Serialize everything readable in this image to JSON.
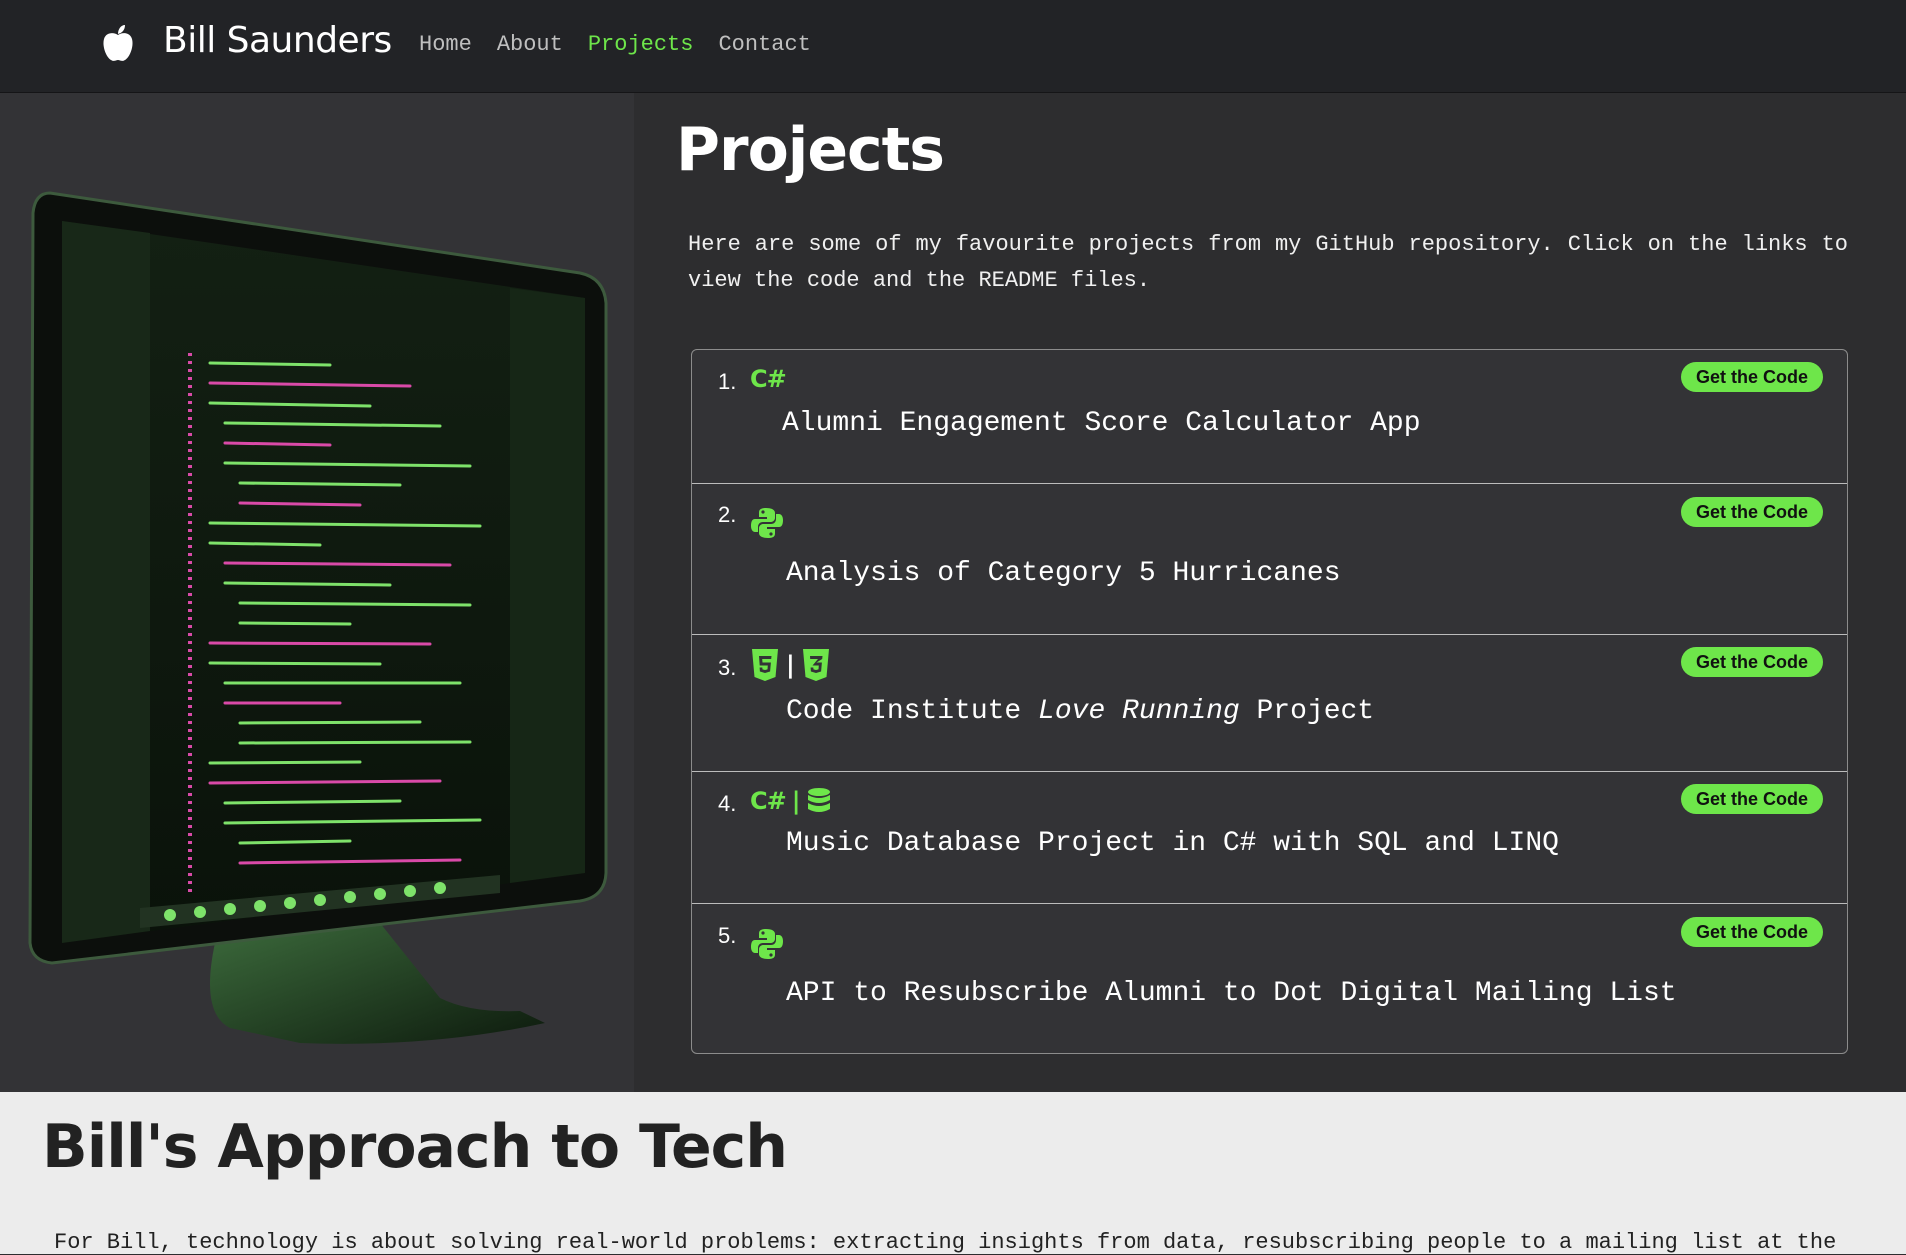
{
  "nav": {
    "brand": "Bill Saunders",
    "brand_icon": "apple-icon",
    "links": [
      "Home",
      "About",
      "Projects",
      "Contact"
    ],
    "active": "Projects"
  },
  "projects_section": {
    "title": "Projects",
    "intro": "Here are some of my favourite projects from my GitHub repository. Click on the links to view the code and the README files.",
    "button_label": "Get the Code",
    "items": [
      {
        "number": "1.",
        "icons": [
          "csharp-icon"
        ],
        "icon_text": "C#",
        "title": "Alumni Engagement Score Calculator App"
      },
      {
        "number": "2.",
        "icons": [
          "python-icon"
        ],
        "title": "Analysis of Category 5 Hurricanes"
      },
      {
        "number": "3.",
        "icons": [
          "html5-icon",
          "css3-icon"
        ],
        "title_pre": "Code Institute ",
        "title_em": "Love Running",
        "title_post": " Project"
      },
      {
        "number": "4.",
        "icons": [
          "csharp-icon",
          "database-icon"
        ],
        "icon_text": "C#",
        "title": "Music Database Project in C# with SQL and LINQ"
      },
      {
        "number": "5.",
        "icons": [
          "python-icon"
        ],
        "title": "API to Resubscribe Alumni to Dot Digital Mailing List"
      }
    ]
  },
  "approach_section": {
    "title": "Bill's Approach to Tech",
    "text": "For Bill, technology is about solving real-world problems: extracting insights from data, resubscribing people to a mailing list at the"
  },
  "colors": {
    "accent": "#6ee64a",
    "nav_bg": "#222326",
    "panel_bg": "#2d2d2f",
    "light_bg": "#ececec"
  }
}
